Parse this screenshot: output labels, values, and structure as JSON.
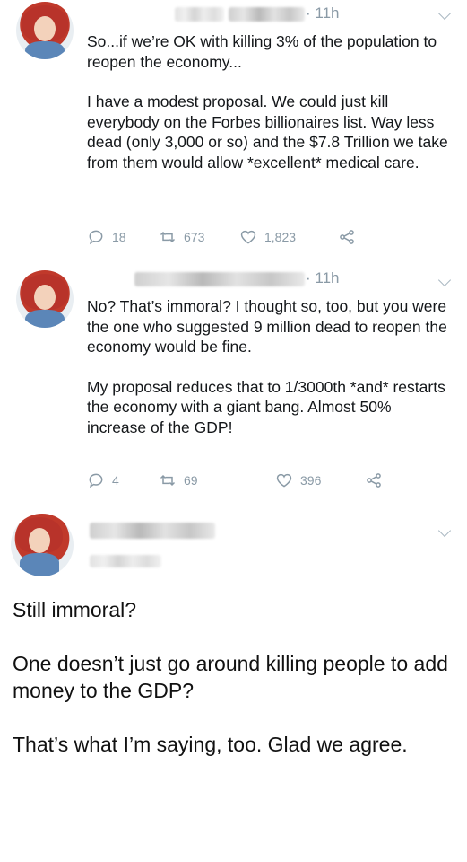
{
  "tweets": [
    {
      "time": "· 11h",
      "paragraphs": [
        "So...if we’re OK with killing 3% of the population to reopen the economy...",
        "I have a modest proposal. We could just kill everybody on the Forbes billionaires list. Way less dead (only 3,000 or so) and the $7.8 Trillion we take from them would allow *excellent* medical care."
      ],
      "replies": "18",
      "retweets": "673",
      "likes": "1,823"
    },
    {
      "time": "· 11h",
      "paragraphs": [
        "No? That’s immoral? I thought so, too, but you were the one who suggested 9 million dead to reopen the economy would be fine.",
        "My proposal reduces that to 1/3000th *and* restarts the economy with a giant bang. Almost 50% increase of the GDP!"
      ],
      "replies": "4",
      "retweets": "69",
      "likes": "396"
    },
    {
      "paragraphs": [
        "Still immoral?",
        "One doesn’t just go around killing people to add money to the GDP?",
        "That’s what I’m saying, too. Glad we agree."
      ]
    }
  ],
  "icons": {
    "reply": "reply-icon",
    "retweet": "retweet-icon",
    "like": "heart-icon",
    "share": "share-icon",
    "menu": "chevron-down-icon"
  },
  "colors": {
    "text": "#14171a",
    "muted": "#8a9aa6"
  }
}
